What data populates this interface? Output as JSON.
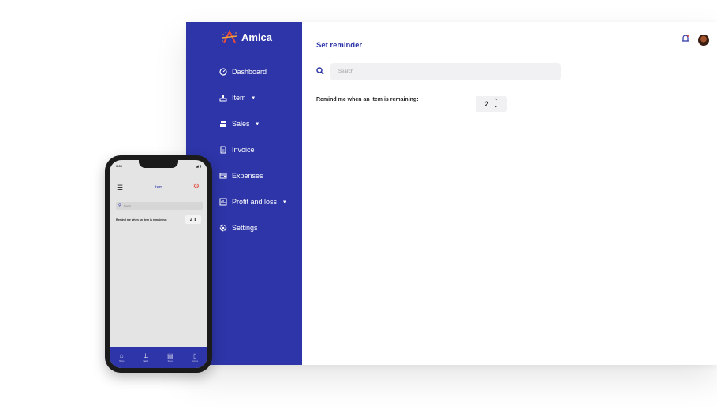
{
  "brand": {
    "name": "Amica"
  },
  "sidebar": {
    "items": [
      {
        "label": "Dashboard",
        "icon": "dashboard-icon",
        "caret": ""
      },
      {
        "label": "Item",
        "icon": "item-icon",
        "caret": "▾"
      },
      {
        "label": "Sales",
        "icon": "register-icon",
        "caret": "▾"
      },
      {
        "label": "Invoice",
        "icon": "invoice-icon",
        "caret": ""
      },
      {
        "label": "Expenses",
        "icon": "expenses-icon",
        "caret": ""
      },
      {
        "label": "Profit and loss",
        "icon": "chart-icon",
        "caret": "▾"
      },
      {
        "label": "Settings",
        "icon": "gear-icon",
        "caret": ""
      }
    ]
  },
  "main": {
    "title": "Set reminder",
    "search_placeholder": "Search",
    "reminder_label": "Remind me when an item is remaining:",
    "reminder_value": "2"
  },
  "phone": {
    "time": "9:30",
    "signal": "◢ ▮",
    "title": "Item",
    "search_placeholder": "Search",
    "reminder_label": "Remind me when an item is remaining:",
    "reminder_value": "2",
    "tabs": [
      {
        "label": "Home",
        "icon": "home-icon"
      },
      {
        "label": "Items",
        "icon": "item-icon"
      },
      {
        "label": "Sales",
        "icon": "register-icon"
      },
      {
        "label": "Invoice",
        "icon": "invoice-icon"
      }
    ]
  },
  "colors": {
    "primary": "#2d35a8",
    "accent": "#e44b3d",
    "background": "#ffffff"
  }
}
